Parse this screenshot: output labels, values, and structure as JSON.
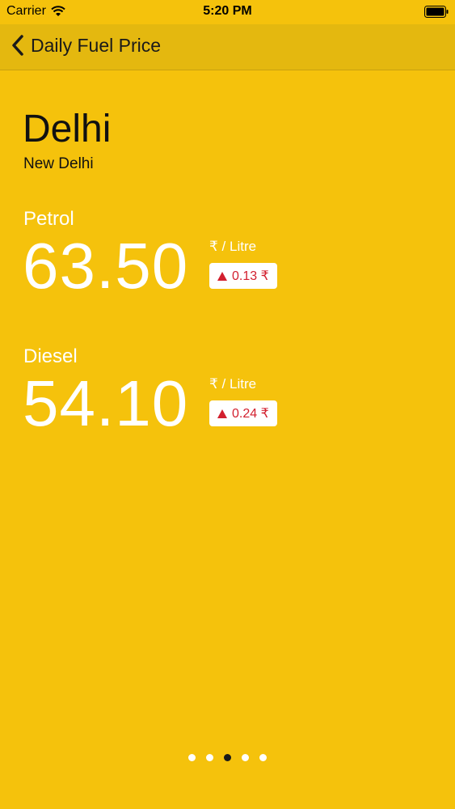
{
  "status_bar": {
    "carrier": "Carrier",
    "time": "5:20 PM"
  },
  "nav": {
    "title": "Daily Fuel Price"
  },
  "location": {
    "city": "Delhi",
    "region": "New Delhi"
  },
  "fuels": [
    {
      "label": "Petrol",
      "price": "63.50",
      "unit": "₹ / Litre",
      "change": "0.13 ₹",
      "direction": "up"
    },
    {
      "label": "Diesel",
      "price": "54.10",
      "unit": "₹ / Litre",
      "change": "0.24 ₹",
      "direction": "up"
    }
  ],
  "pagination": {
    "total": 5,
    "active_index": 2
  },
  "colors": {
    "background": "#F5C20C",
    "nav_background": "#E4B80F",
    "change_up": "#D21F2E"
  }
}
